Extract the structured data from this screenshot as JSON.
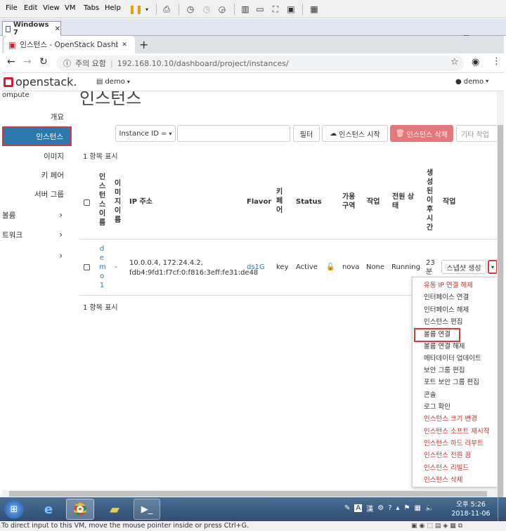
{
  "vm": {
    "menu": [
      "File",
      "Edit",
      "View",
      "VM",
      "Tabs",
      "Help"
    ],
    "tab_label": "Windows 7",
    "status_text": "To direct input to this VM, move the mouse pointer inside or press Ctrl+G."
  },
  "browser": {
    "tab_title": "인스턴스 - OpenStack Dashboa",
    "security_label": "주의 요함",
    "url": "192.168.10.10/dashboard/project/instances/"
  },
  "header": {
    "logo_text": "openstack.",
    "project": "demo",
    "user": "demo"
  },
  "page": {
    "title": "인스턴스"
  },
  "sidebar": {
    "section": "ompute",
    "items": [
      {
        "label": "개요"
      },
      {
        "label": "인스턴스"
      },
      {
        "label": "이미지"
      },
      {
        "label": "키 페어"
      },
      {
        "label": "서버 그룹"
      }
    ],
    "groups": [
      {
        "label": "볼륨"
      },
      {
        "label": "트워크"
      },
      {
        "label": ""
      }
    ]
  },
  "toolbar": {
    "filter_select": "Instance ID =",
    "filter_value": "",
    "filter_button": "필터",
    "launch_button": "인스턴스 시작",
    "delete_button": "인스턴스 삭제",
    "more_button": "기타 작업"
  },
  "table": {
    "count_top": "1 항목 표시",
    "count_bottom": "1 항목 표시",
    "headers": {
      "name": "인스턴스이름",
      "image": "이미지이름",
      "ip": "IP 주소",
      "flavor": "Flavor",
      "keypair": "키페어",
      "status": "Status",
      "az": "가용구역",
      "task": "작업",
      "power": "전원 상태",
      "age": "생성된이후시간",
      "actions": "작업"
    },
    "row": {
      "name": "demo1",
      "image": "-",
      "ip_line1": "10.0.0.4, 172.24.4.2,",
      "ip_line2": "fdb4:9fd1:f7cf:0:f816:3eff:fe31:de48",
      "flavor": "ds1G",
      "keypair": "key",
      "status": "Active",
      "az": "nova",
      "task": "None",
      "power": "Running",
      "age": "23분",
      "action_button": "스냅샷 생성"
    }
  },
  "dropdown": {
    "items": [
      {
        "label": "유동 IP 연결 해제",
        "danger": true
      },
      {
        "label": "인터페이스 연결",
        "danger": false
      },
      {
        "label": "인터페이스 해제",
        "danger": false
      },
      {
        "label": "인스턴스 편집",
        "danger": false
      },
      {
        "label": "볼륨 연결",
        "danger": false,
        "highlighted": true
      },
      {
        "label": "볼륨 연결 해제",
        "danger": false
      },
      {
        "label": "메타데이터 업데이트",
        "danger": false
      },
      {
        "label": "보안 그룹 편집",
        "danger": false
      },
      {
        "label": "포트 보안 그룹 편집",
        "danger": false
      },
      {
        "label": "콘솔",
        "danger": false
      },
      {
        "label": "로그 확인",
        "danger": false
      },
      {
        "label": "인스턴스 크기 변경",
        "danger": true
      },
      {
        "label": "인스턴스 소프트 재시작",
        "danger": true
      },
      {
        "label": "인스턴스 하드 리부트",
        "danger": true
      },
      {
        "label": "인스턴스 전원 끔",
        "danger": true
      },
      {
        "label": "인스턴스 리빌드",
        "danger": true
      },
      {
        "label": "인스턴스 삭제",
        "danger": true
      }
    ]
  },
  "taskbar": {
    "time": "오후 5:26",
    "date": "2018-11-06",
    "ime": "A",
    "ime2": "漢"
  },
  "colors": {
    "highlight_border": "#d9363e",
    "link": "#2a7ab0",
    "danger": "#c9302c",
    "delete_button": "#e7787a",
    "active_sidebar": "#2a7ab0"
  }
}
